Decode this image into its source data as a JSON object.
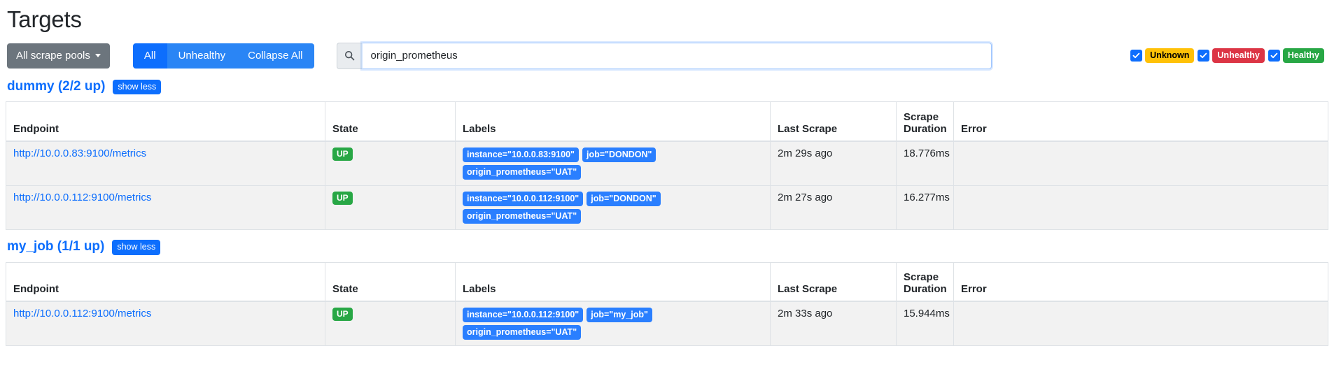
{
  "header": {
    "title": "Targets"
  },
  "toolbar": {
    "scrape_pool_label": "All scrape pools",
    "caret_icon": "chevron-down-icon",
    "filters": [
      {
        "label": "All",
        "active": true
      },
      {
        "label": "Unhealthy",
        "active": false
      },
      {
        "label": "Collapse All",
        "active": false
      }
    ],
    "search": {
      "icon": "search-icon",
      "value": "origin_prometheus",
      "placeholder": "Filter by endpoint or labels"
    },
    "status_filters": [
      {
        "label": "Unknown",
        "checked": true,
        "color": "#ffc107"
      },
      {
        "label": "Unhealthy",
        "checked": true,
        "color": "#dc3545"
      },
      {
        "label": "Healthy",
        "checked": true,
        "color": "#28a745"
      }
    ]
  },
  "table_headers": {
    "endpoint": "Endpoint",
    "state": "State",
    "labels": "Labels",
    "last_scrape": "Last Scrape",
    "scrape_duration_line1": "Scrape",
    "scrape_duration_line2": "Duration",
    "error": "Error"
  },
  "jobs": [
    {
      "title": "dummy (2/2 up)",
      "toggle_label": "show less",
      "rows": [
        {
          "endpoint": "http://10.0.0.83:9100/metrics",
          "state": "UP",
          "labels": [
            "instance=\"10.0.0.83:9100\"",
            "job=\"DONDON\"",
            "origin_prometheus=\"UAT\""
          ],
          "last_scrape": "2m 29s ago",
          "scrape_duration": "18.776ms",
          "error": ""
        },
        {
          "endpoint": "http://10.0.0.112:9100/metrics",
          "state": "UP",
          "labels": [
            "instance=\"10.0.0.112:9100\"",
            "job=\"DONDON\"",
            "origin_prometheus=\"UAT\""
          ],
          "last_scrape": "2m 27s ago",
          "scrape_duration": "16.277ms",
          "error": ""
        }
      ]
    },
    {
      "title": "my_job (1/1 up)",
      "toggle_label": "show less",
      "rows": [
        {
          "endpoint": "http://10.0.0.112:9100/metrics",
          "state": "UP",
          "labels": [
            "instance=\"10.0.0.112:9100\"",
            "job=\"my_job\"",
            "origin_prometheus=\"UAT\""
          ],
          "last_scrape": "2m 33s ago",
          "scrape_duration": "15.944ms",
          "error": ""
        }
      ]
    }
  ]
}
